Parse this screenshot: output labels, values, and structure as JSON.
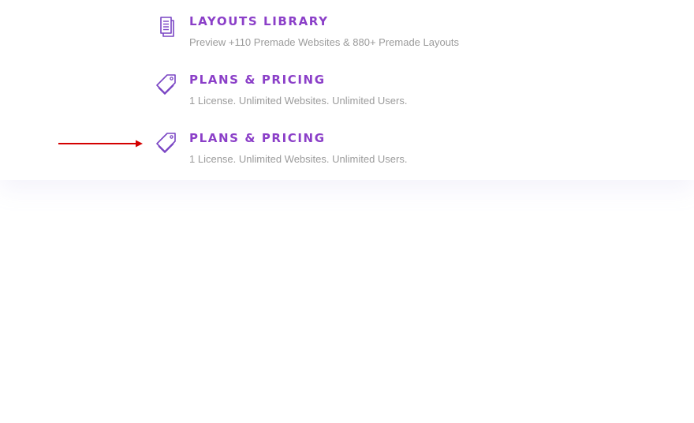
{
  "colors": {
    "accent": "#8b3fc8",
    "muted": "#9b9b9b",
    "icon": "#7a45c4",
    "arrow": "#d40000"
  },
  "menu": {
    "items": [
      {
        "icon": "document-stack-icon",
        "title": "LAYOUTS LIBRARY",
        "description": "Preview +110 Premade Websites & 880+ Premade Layouts"
      },
      {
        "icon": "price-tag-icon",
        "title": "PLANS & PRICING",
        "description": "1  License. Unlimited Websites. Unlimited Users."
      },
      {
        "icon": "price-tag-icon",
        "title": "PLANS & PRICING",
        "description": "1  License. Unlimited Websites. Unlimited Users."
      }
    ]
  },
  "annotation": {
    "icon": "red-arrow-icon"
  }
}
